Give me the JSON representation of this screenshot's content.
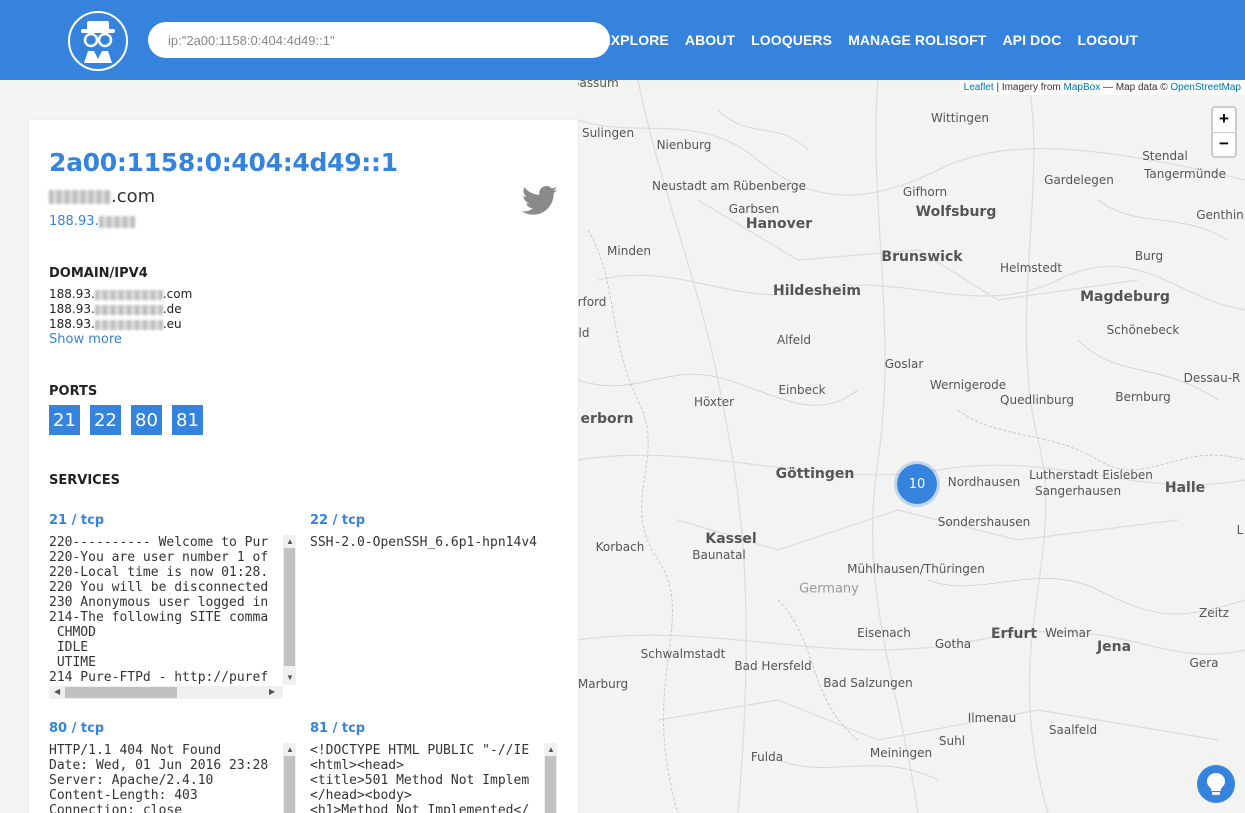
{
  "header": {
    "search_value": "ip:\"2a00:1158:0:404:4d49::1\"",
    "nav": [
      "EXPLORE",
      "ABOUT",
      "LOOQUERS",
      "MANAGE ROLISOFT",
      "API DOC",
      "LOGOUT"
    ]
  },
  "panel": {
    "ip": "2a00:1158:0:404:4d49::1",
    "host_suffix": ".com",
    "ipv4_prefix": "188.93.",
    "domain_section": {
      "title": "DOMAIN/IPV4",
      "rows": [
        {
          "prefix": "188.93.",
          "suffix": ".com"
        },
        {
          "prefix": "188.93.",
          "suffix": ".de"
        },
        {
          "prefix": "188.93.",
          "suffix": ".eu"
        }
      ],
      "show_more": "Show more"
    },
    "ports_section": {
      "title": "PORTS",
      "ports": [
        "21",
        "22",
        "80",
        "81"
      ]
    },
    "services_section": {
      "title": "SERVICES",
      "services": [
        {
          "label": "21 / tcp",
          "text": "220---------- Welcome to Pur\n220-You are user number 1 of\n220-Local time is now 01:28.\n220 You will be disconnected\n230 Anonymous user logged in\n214-The following SITE comma\n CHMOD\n IDLE\n UTIME\n214 Pure-FTPd - http://puref"
        },
        {
          "label": "22 / tcp",
          "text": "SSH-2.0-OpenSSH_6.6p1-hpn14v4"
        },
        {
          "label": "80 / tcp",
          "text": "HTTP/1.1 404 Not Found\nDate: Wed, 01 Jun 2016 23:28\nServer: Apache/2.4.10\nContent-Length: 403\nConnection: close"
        },
        {
          "label": "81 / tcp",
          "text": "<!DOCTYPE HTML PUBLIC \"-//IE\n<html><head>\n<title>501 Method Not Implem\n</head><body>\n<h1>Method Not Implemented</"
        }
      ]
    }
  },
  "map": {
    "attribution": {
      "leaflet": "Leaflet",
      "imagery": " | Imagery from ",
      "mapbox": "MapBox",
      "mapdata": " — Map data © ",
      "osm": "OpenStreetMap"
    },
    "zoom_in": "+",
    "zoom_out": "−",
    "cluster_count": "10",
    "places": [
      "Bassum",
      "Wittingen",
      "Sulingen",
      "Nienburg",
      "Stendal",
      "Tangermünde",
      "Neustadt am Rübenberge",
      "Gifhorn",
      "Gardelegen",
      "Garbsen",
      "Wolfsburg",
      "Hanover",
      "Genthin",
      "Minden",
      "Brunswick",
      "Helmstedt",
      "Burg",
      "Hildesheim",
      "Magdeburg",
      "rford",
      "Schönebeck",
      "Alfeld",
      "ld",
      "Goslar",
      "Einbeck",
      "Wernigerode",
      "Dessau-R",
      "Höxter",
      "Quedlinburg",
      "Bernburg",
      "erborn",
      "Göttingen",
      "Nordhausen",
      "Lutherstadt Eisleben",
      "Sangerhausen",
      "Halle",
      "Sondershausen",
      "Kassel",
      "Korbach",
      "Baunatal",
      "L",
      "Mühlhausen/Thüringen",
      "Germany",
      "Zeitz",
      "Eisenach",
      "Erfurt",
      "Weimar",
      "Gotha",
      "Jena",
      "Schwalmstadt",
      "Bad Hersfeld",
      "Gera",
      "Marburg",
      "Bad Salzungen",
      "Ilmenau",
      "Saalfeld",
      "Suhl",
      "Meiningen",
      "Fulda"
    ]
  }
}
